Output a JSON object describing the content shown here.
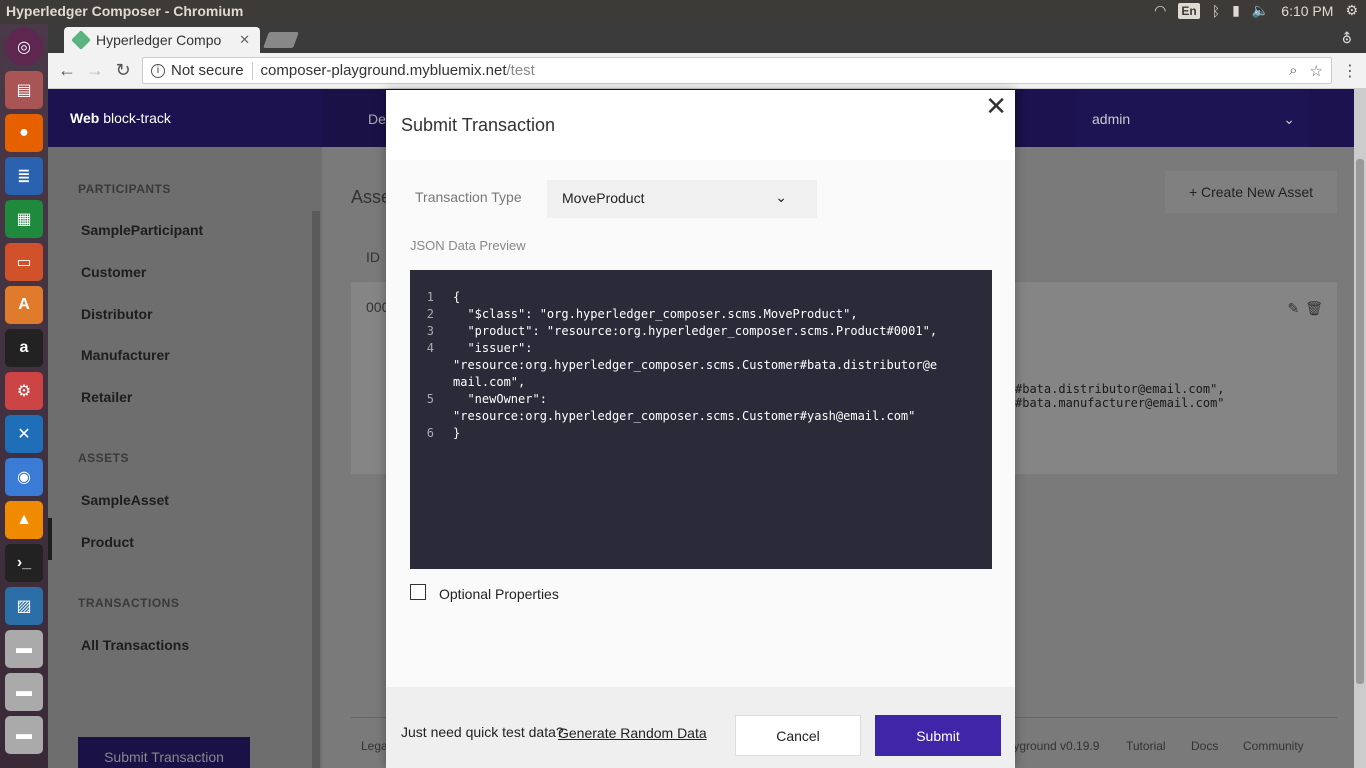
{
  "os": {
    "window_title": "Hyperledger Composer - Chromium",
    "keyboard": "En",
    "clock": "6:10 PM"
  },
  "browser": {
    "tab_title": "Hyperledger Compo",
    "security": "Not secure",
    "url_host": "composer-playground.mybluemix.net",
    "url_path": "/test"
  },
  "app": {
    "brand_bold": "Web",
    "brand_rest": "block-track",
    "nav_item": "De",
    "user": "admin"
  },
  "sidebar": {
    "participants_heading": "PARTICIPANTS",
    "participants": [
      "SampleParticipant",
      "Customer",
      "Distributor",
      "Manufacturer",
      "Retailer"
    ],
    "assets_heading": "ASSETS",
    "assets": [
      "SampleAsset",
      "Product"
    ],
    "transactions_heading": "TRANSACTIONS",
    "transactions": [
      "All Transactions"
    ],
    "submit_button": "Submit Transaction"
  },
  "background": {
    "heading": "Asse",
    "create_button": "+ Create New Asset",
    "id_col": "ID",
    "row_id": "000",
    "row_code_1": "#bata.distributor@email.com\",",
    "row_code_2": "#bata.manufacturer@email.com\"",
    "footer": [
      "Lega",
      "layground v0.19.9",
      "Tutorial",
      "Docs",
      "Community"
    ]
  },
  "modal": {
    "title": "Submit Transaction",
    "transaction_type_label": "Transaction Type",
    "transaction_type_value": "MoveProduct",
    "json_label": "JSON Data Preview",
    "code_lines": [
      {
        "n": "1",
        "text": "{"
      },
      {
        "n": "2",
        "text": "  \"$class\": \"org.hyperledger_composer.scms.MoveProduct\","
      },
      {
        "n": "3",
        "text": "  \"product\": \"resource:org.hyperledger_composer.scms.Product#0001\","
      },
      {
        "n": "4",
        "text": "  \"issuer\":"
      },
      {
        "n": "",
        "text": "\"resource:org.hyperledger_composer.scms.Customer#bata.distributor@e"
      },
      {
        "n": "",
        "text": "mail.com\","
      },
      {
        "n": "5",
        "text": "  \"newOwner\":"
      },
      {
        "n": "",
        "text": "\"resource:org.hyperledger_composer.scms.Customer#yash@email.com\""
      },
      {
        "n": "6",
        "text": "}"
      }
    ],
    "optional_label": "Optional Properties",
    "quick_text": "Just need quick test data?",
    "generate_link": "Generate Random Data",
    "cancel": "Cancel",
    "submit": "Submit"
  }
}
